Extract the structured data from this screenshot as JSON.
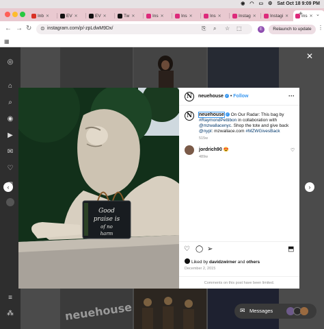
{
  "menubar": {
    "datetime": "Sat Oct 18  9:09 PM"
  },
  "tabs": [
    {
      "label": "Inb",
      "color": "#d93025"
    },
    {
      "label": "EV",
      "color": "#111111"
    },
    {
      "label": "EV",
      "color": "#111111"
    },
    {
      "label": "Tw",
      "color": "#111111"
    },
    {
      "label": "Ins",
      "color": "#dd2a7b"
    },
    {
      "label": "Ins",
      "color": "#dd2a7b"
    },
    {
      "label": "Ins",
      "color": "#dd2a7b"
    },
    {
      "label": "Instag",
      "color": "#dd2a7b"
    },
    {
      "label": "Instagi",
      "color": "#dd2a7b"
    },
    {
      "label": "Ins",
      "color": "#dd2a7b",
      "active": true
    }
  ],
  "toolbar": {
    "url": "instagram.com/p/-zpLdwM9Dx/",
    "relaunch_label": "Relaunch to update",
    "profile_initial": "E"
  },
  "post": {
    "username": "neuehouse",
    "follow_label": "Follow",
    "caption_user": "neuehouse",
    "caption_parts": [
      {
        "text": " On Our Radar: This bag by ",
        "link": false
      },
      {
        "text": "#RaymondPettibon",
        "link": true
      },
      {
        "text": " in collaboration with ",
        "link": false
      },
      {
        "text": "@mzwallacenyc",
        "link": true
      },
      {
        "text": ". Shop the tote and give back ",
        "link": false
      },
      {
        "text": "@nypl",
        "link": true
      },
      {
        "text": ": mzwallace.com ",
        "link": false
      },
      {
        "text": "#MZWGivesBack",
        "link": true
      }
    ],
    "caption_age": "515w",
    "comment_user": "jordrich90",
    "comment_emoji": "😍",
    "comment_age": "489w",
    "likes_prefix": "Liked by ",
    "likes_user": "davidzwirner",
    "likes_and": " and ",
    "likes_others": "others",
    "date": "December 2, 2015",
    "comments_limited": "Comments on this post have been limited.",
    "bag_text": "Good praise is no harm"
  },
  "messages": {
    "label": "Messages"
  }
}
